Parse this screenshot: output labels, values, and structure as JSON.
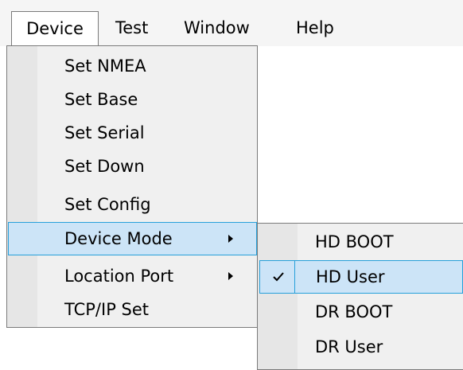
{
  "menubar": {
    "items": [
      {
        "label": "Device"
      },
      {
        "label": "Test"
      },
      {
        "label": "Window"
      },
      {
        "label": "Help"
      }
    ]
  },
  "device_menu": {
    "items": [
      {
        "label": "Set NMEA"
      },
      {
        "label": "Set Base"
      },
      {
        "label": "Set Serial"
      },
      {
        "label": "Set Down"
      },
      {
        "label": "Set Config"
      },
      {
        "label": "Device Mode"
      },
      {
        "label": "Location Port"
      },
      {
        "label": "TCP/IP Set"
      }
    ]
  },
  "device_mode_submenu": {
    "items": [
      {
        "label": "HD BOOT"
      },
      {
        "label": "HD User",
        "checked": true
      },
      {
        "label": "DR BOOT"
      },
      {
        "label": "DR User"
      }
    ]
  },
  "colors": {
    "highlight_fill": "#cce4f7",
    "highlight_border": "#26a0da",
    "menu_bg": "#f0f0f0"
  }
}
